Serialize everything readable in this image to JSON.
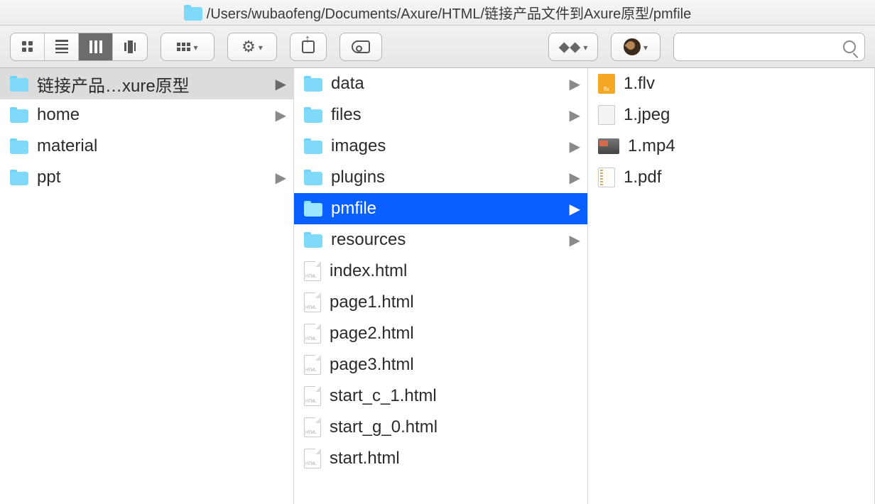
{
  "title": "/Users/wubaofeng/Documents/Axure/HTML/链接产品文件到Axure原型/pmfile",
  "col1": [
    {
      "label": "链接产品…xure原型",
      "type": "folder",
      "arrow": true,
      "sel": "grey"
    },
    {
      "label": "home",
      "type": "folder",
      "arrow": true
    },
    {
      "label": "material",
      "type": "folder",
      "arrow": false
    },
    {
      "label": "ppt",
      "type": "folder",
      "arrow": true
    }
  ],
  "col2": [
    {
      "label": "data",
      "type": "folder",
      "arrow": true
    },
    {
      "label": "files",
      "type": "folder",
      "arrow": true
    },
    {
      "label": "images",
      "type": "folder",
      "arrow": true
    },
    {
      "label": "plugins",
      "type": "folder",
      "arrow": true
    },
    {
      "label": "pmfile",
      "type": "folder",
      "arrow": true,
      "sel": "blue"
    },
    {
      "label": "resources",
      "type": "folder",
      "arrow": true
    },
    {
      "label": "index.html",
      "type": "html"
    },
    {
      "label": "page1.html",
      "type": "html"
    },
    {
      "label": "page2.html",
      "type": "html"
    },
    {
      "label": "page3.html",
      "type": "html"
    },
    {
      "label": "start_c_1.html",
      "type": "html"
    },
    {
      "label": "start_g_0.html",
      "type": "html"
    },
    {
      "label": "start.html",
      "type": "html"
    }
  ],
  "col3": [
    {
      "label": "1.flv",
      "type": "flv"
    },
    {
      "label": "1.jpeg",
      "type": "jpeg"
    },
    {
      "label": "1.mp4",
      "type": "mp4"
    },
    {
      "label": "1.pdf",
      "type": "pdf"
    }
  ],
  "flv_badge": "flv"
}
